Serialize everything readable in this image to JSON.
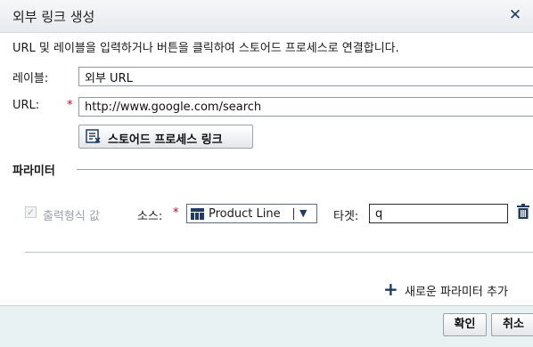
{
  "dialog": {
    "title": "외부 링크 생성",
    "instructions": "URL 및 레이블을 입력하거나 버튼을 클릭하여 스토어드 프로세스로 연결합니다."
  },
  "form": {
    "label_label": "레이블:",
    "label_value": "외부 URL",
    "url_label": "URL:",
    "required_marker": "*",
    "url_value": "http://www.google.com/search",
    "stored_process_button": "스토어드 프로세스 링크"
  },
  "parameters": {
    "section_title": "파라미터",
    "row": {
      "formatted_value_label": "출력형식 값",
      "formatted_value_checked": true,
      "source_label": "소스:",
      "source_value": "Product Line",
      "target_label": "타겟:",
      "target_value": "q"
    },
    "add_label": "새로운 파라미터 추가"
  },
  "footer": {
    "ok_label": "확인",
    "cancel_label": "취소"
  },
  "icons": {
    "close": "close-icon",
    "stored_process": "stored-process-icon",
    "category": "category-data-icon",
    "dropdown": "chevron-down-icon",
    "delete": "trash-icon",
    "add": "plus-icon"
  },
  "colors": {
    "required": "#d0021b",
    "accent": "#1f3b60",
    "footer_bg": "#e9f2f2"
  }
}
